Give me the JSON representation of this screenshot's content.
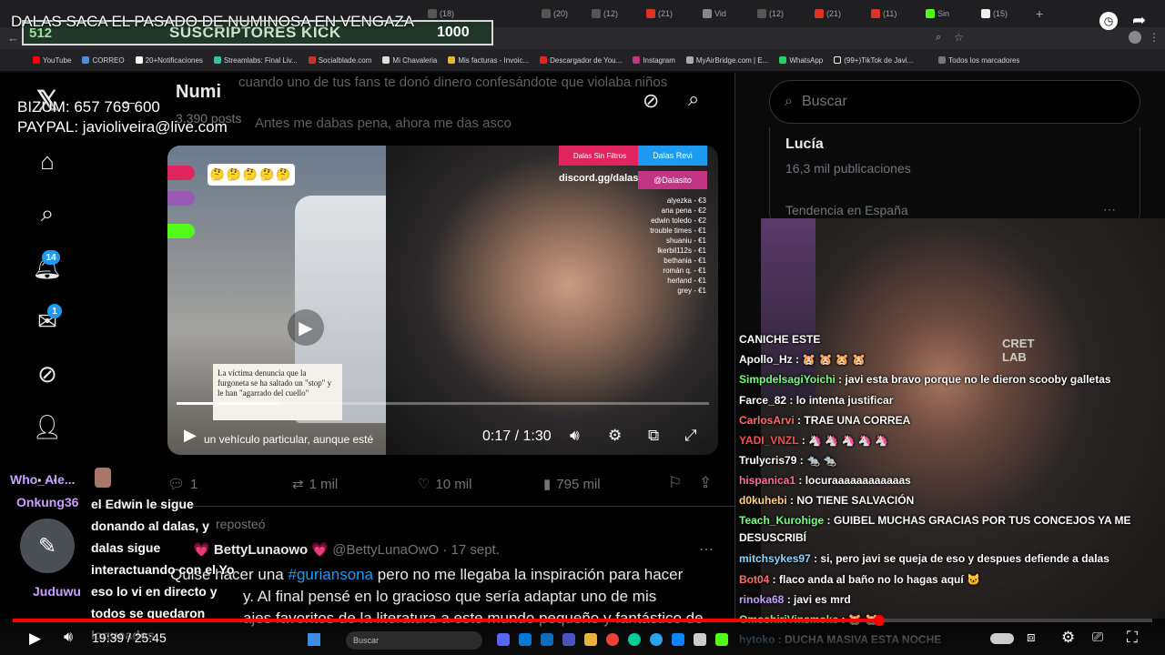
{
  "overlay": {
    "video_title": "DALAS SACA EL PASADO DE NUMINOSA EN VENGAZA",
    "subs_left": "512",
    "subs_label": "SUSCRIPTORES KICK",
    "subs_goal": "1000",
    "bizum": "BIZUM: 657 769 600",
    "paypal": "PAYPAL: javioliveira@live.com"
  },
  "browser": {
    "tabs": [
      "(18)",
      "(20)",
      "(12)",
      "(21)",
      "Vid",
      "(12)",
      "(21)",
      "(11)",
      "Sin",
      "(15)"
    ],
    "bookmarks": [
      "YouTube",
      "CORREO",
      "20+Notificaciones",
      "Streamlabs: Final Liv...",
      "Socialblade.com",
      "Mi Chavaleria",
      "Mis facturas - Invoic...",
      "Descargador de You...",
      "Instagram",
      "MyAirBridge.com | E...",
      "WhatsApp",
      "(99+)TikTok de Javi...",
      "Todos los marcadores"
    ]
  },
  "x": {
    "profile_name": "Numi",
    "post_count": "3.390 posts",
    "bg_text_1": "cuando uno de tus fans te donó dinero confesándote que violaba niños",
    "bg_text_2": "Antes me dabas pena, ahora me das asco",
    "badge_notifications": "14",
    "badge_messages": "1",
    "video": {
      "emoji_row": "🤔🤔🤔🤔🤔",
      "tag_blue": "Dalas Revi",
      "tag_red": "Dalas Sin Filtros",
      "tag_ig": "@Dalasito",
      "discord": "discord.gg/dalas",
      "donors": [
        "alyezka - €3",
        "ana pena - €2",
        "edwin toledo - €2",
        "trouble times - €1",
        "shuaniu - €1",
        "lkerbil112s - €1",
        "bethania - €1",
        "román q. - €1",
        "herland - €1",
        "grey - €1"
      ],
      "caption": "La víctima denuncia que la furgoneta se ha saltado un \"stop\" y le han \"agarrado del cuello\"",
      "sub_text": "un vehículo particular, aunque esté",
      "time": "0:17 / 1:30",
      "progress": 0.19
    },
    "actions": {
      "replies": "1",
      "reposts": "1 mil",
      "likes": "10 mil",
      "views": "795 mil"
    },
    "repost_label": "reposteó",
    "author_name": "BettyLunaowo",
    "author_handle": "@BettyLunaOwO · 17 sept.",
    "tweet_text_1": "Quise hacer una",
    "tweet_hashtag": "#guriansona",
    "tweet_text_2": "pero no me llegaba la inspiración para hacer",
    "tweet_text_3": "y. Al final pensé en lo gracioso que sería adaptar uno de mis",
    "tweet_text_4": "ajes favoritos de la literatura a este mundo pequeño y fantástico de",
    "search_placeholder": "Buscar",
    "trend_name": "Lucía",
    "trend_count": "16,3 mil publicaciones",
    "trend_location": "Tendencia en España"
  },
  "chat": [
    {
      "user": "CANICHE ESTE",
      "color": "#ffffff",
      "msg": ""
    },
    {
      "user": "Apollo_Hz",
      "color": "#ffffff",
      "msg": "🐹 🐹 🐹 🐹"
    },
    {
      "user": "SimpdelsagiYoichi",
      "color": "#7cfc7c",
      "msg": "javi esta bravo porque no le dieron scooby galletas"
    },
    {
      "user": "Farce_82",
      "color": "#ffffff",
      "msg": "lo intenta justificar"
    },
    {
      "user": "CarlosArvi",
      "color": "#ff6b6b",
      "msg": "TRAE UNA CORREA"
    },
    {
      "user": "YADI_VNZL",
      "color": "#ff4d4d",
      "msg": "🦄 🦄 🦄 🦄 🦄"
    },
    {
      "user": "Trulycris79",
      "color": "#ffffff",
      "msg": "🐀 🐀"
    },
    {
      "user": "hispanica1",
      "color": "#ff6b9a",
      "msg": "locuraaaaaaaaaaaas"
    },
    {
      "user": "d0kuhebi",
      "color": "#ffd27f",
      "msg": "NO TIENE SALVACIÓN"
    },
    {
      "user": "Teach_Kurohige",
      "color": "#7cfc7c",
      "msg": "GUIBEL MUCHAS GRACIAS POR TUS CONCEJOS YA ME DESUSCRIBÍ"
    },
    {
      "user": "mitchsykes97",
      "color": "#8fd3ff",
      "msg": "si, pero javi se queja de eso y despues defiende a dalas"
    },
    {
      "user": "Bot04",
      "color": "#ff6b6b",
      "msg": "flaco anda al baño no lo hagas aquí 🐱"
    },
    {
      "user": "rinoka68",
      "color": "#c9a0ff",
      "msg": "javi es mrd"
    },
    {
      "user": "OmoshiriVinsmoke",
      "color": "#7cfc7c",
      "msg": "🐹 🐹"
    },
    {
      "user": "hytoko",
      "color": "#8fd3ff",
      "msg": "DUCHA MASIVA ESTA NOCHE"
    }
  ],
  "left_chat": {
    "user1": "Who_Ale...",
    "user2": "Onkung36",
    "user3": "Juduwu",
    "message": "el Edwin le sigue donando al dalas, y dalas sigue interactuando con el Yo eso lo vi en directo y todos se quedaron loqueados"
  },
  "player": {
    "time": "19:39 / 25:45",
    "progress": 0.76,
    "taskbar_search": "Buscar"
  }
}
